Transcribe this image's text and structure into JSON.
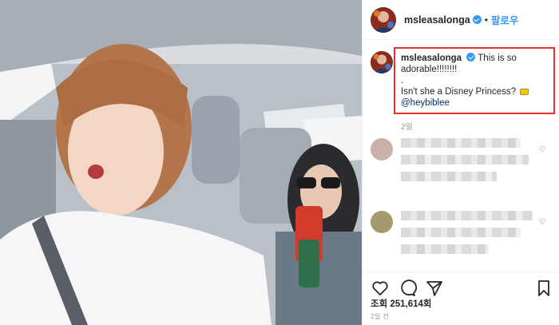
{
  "post": {
    "username": "msleasalonga",
    "dot": "•",
    "follow_label": "팔로우"
  },
  "caption": {
    "username": "msleasalonga",
    "line1": "This is so adorable!!!!!!!!",
    "line2": ".",
    "line3": "Isn't she a Disney Princess?",
    "mention": "@heybiblee",
    "time_ago": "2일"
  },
  "stats": {
    "views": "조회 251,614회",
    "posted": "2일 전"
  },
  "icons": {
    "like": "heart-icon",
    "comment": "comment-icon",
    "share": "share-icon",
    "save": "bookmark-icon"
  },
  "colors": {
    "accent": "#3897f0",
    "highlight_box": "#e0312f",
    "mention": "#003569"
  }
}
